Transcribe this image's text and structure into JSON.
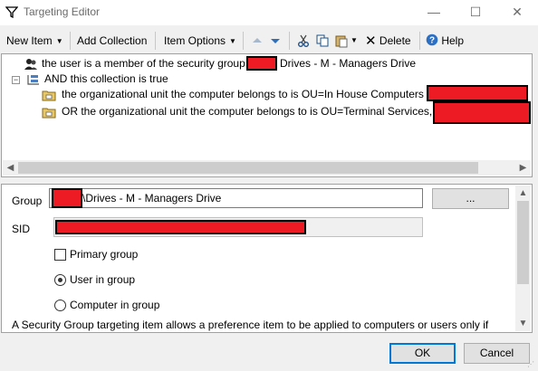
{
  "window": {
    "title": "Targeting Editor",
    "minimize_glyph": "—",
    "maximize_glyph": "☐",
    "close_glyph": "✕"
  },
  "toolbar": {
    "new_item": "New Item",
    "add_collection": "Add Collection",
    "item_options": "Item Options",
    "delete": "Delete",
    "help": "Help",
    "dropdown_glyph": "▼"
  },
  "tree": {
    "rows": [
      {
        "icon": "user-group-icon",
        "text_before": "the user is a member of the security group ",
        "text_after": "Drives - M - Managers Drive"
      },
      {
        "icon": "collection-icon",
        "text_before": "AND this collection is true",
        "text_after": ""
      },
      {
        "icon": "folder-icon",
        "text_before": "the organizational unit the computer belongs to is OU=In House Computers",
        "text_after": ""
      },
      {
        "icon": "folder-icon",
        "text_before": "OR the organizational unit the computer belongs to is OU=Terminal Services,",
        "text_after": ""
      }
    ],
    "collapse_glyph": "−"
  },
  "props": {
    "group_label": "Group",
    "group_value": "\\Drives - M - Managers Drive",
    "browse_label": "...",
    "sid_label": "SID",
    "primary_group_label": "Primary group",
    "primary_group_checked": false,
    "user_in_group_label": "User in group",
    "computer_in_group_label": "Computer in group",
    "selected_radio": "user",
    "description": "A Security Group targeting item allows a preference item to be applied to computers or users only if"
  },
  "buttons": {
    "ok": "OK",
    "cancel": "Cancel"
  },
  "colors": {
    "accent": "#0078d7",
    "redaction": "#ed1c24"
  }
}
